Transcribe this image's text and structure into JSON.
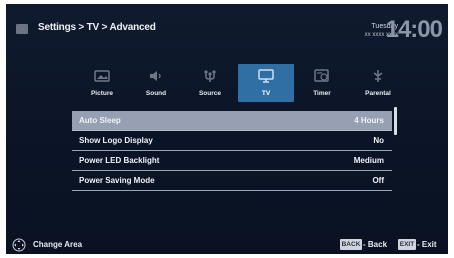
{
  "header": {
    "breadcrumb": "Settings > TV > Advanced",
    "day": "Tuesday",
    "date": "xx xxxx xxxx",
    "clock": "14:00"
  },
  "tabs": [
    {
      "label": "Picture",
      "icon": "picture-icon",
      "active": false
    },
    {
      "label": "Sound",
      "icon": "sound-icon",
      "active": false
    },
    {
      "label": "Source",
      "icon": "source-icon",
      "active": false
    },
    {
      "label": "TV",
      "icon": "tv-icon",
      "active": true
    },
    {
      "label": "Timer",
      "icon": "timer-icon",
      "active": false
    },
    {
      "label": "Parental",
      "icon": "parental-icon",
      "active": false
    }
  ],
  "settings": [
    {
      "name": "Auto Sleep",
      "value": "4 Hours",
      "selected": true
    },
    {
      "name": "Show Logo Display",
      "value": "No",
      "selected": false
    },
    {
      "name": "Power LED Backlight",
      "value": "Medium",
      "selected": false
    },
    {
      "name": "Power Saving Mode",
      "value": "Off",
      "selected": false
    }
  ],
  "footer": {
    "change_area": "Change Area",
    "back_key": "BACK",
    "back_label": "Back",
    "exit_key": "EXIT",
    "exit_label": "Exit"
  },
  "colors": {
    "background": "#0b1426",
    "active_tab": "#2f6fa4",
    "selected_row": "#96a0b2"
  }
}
